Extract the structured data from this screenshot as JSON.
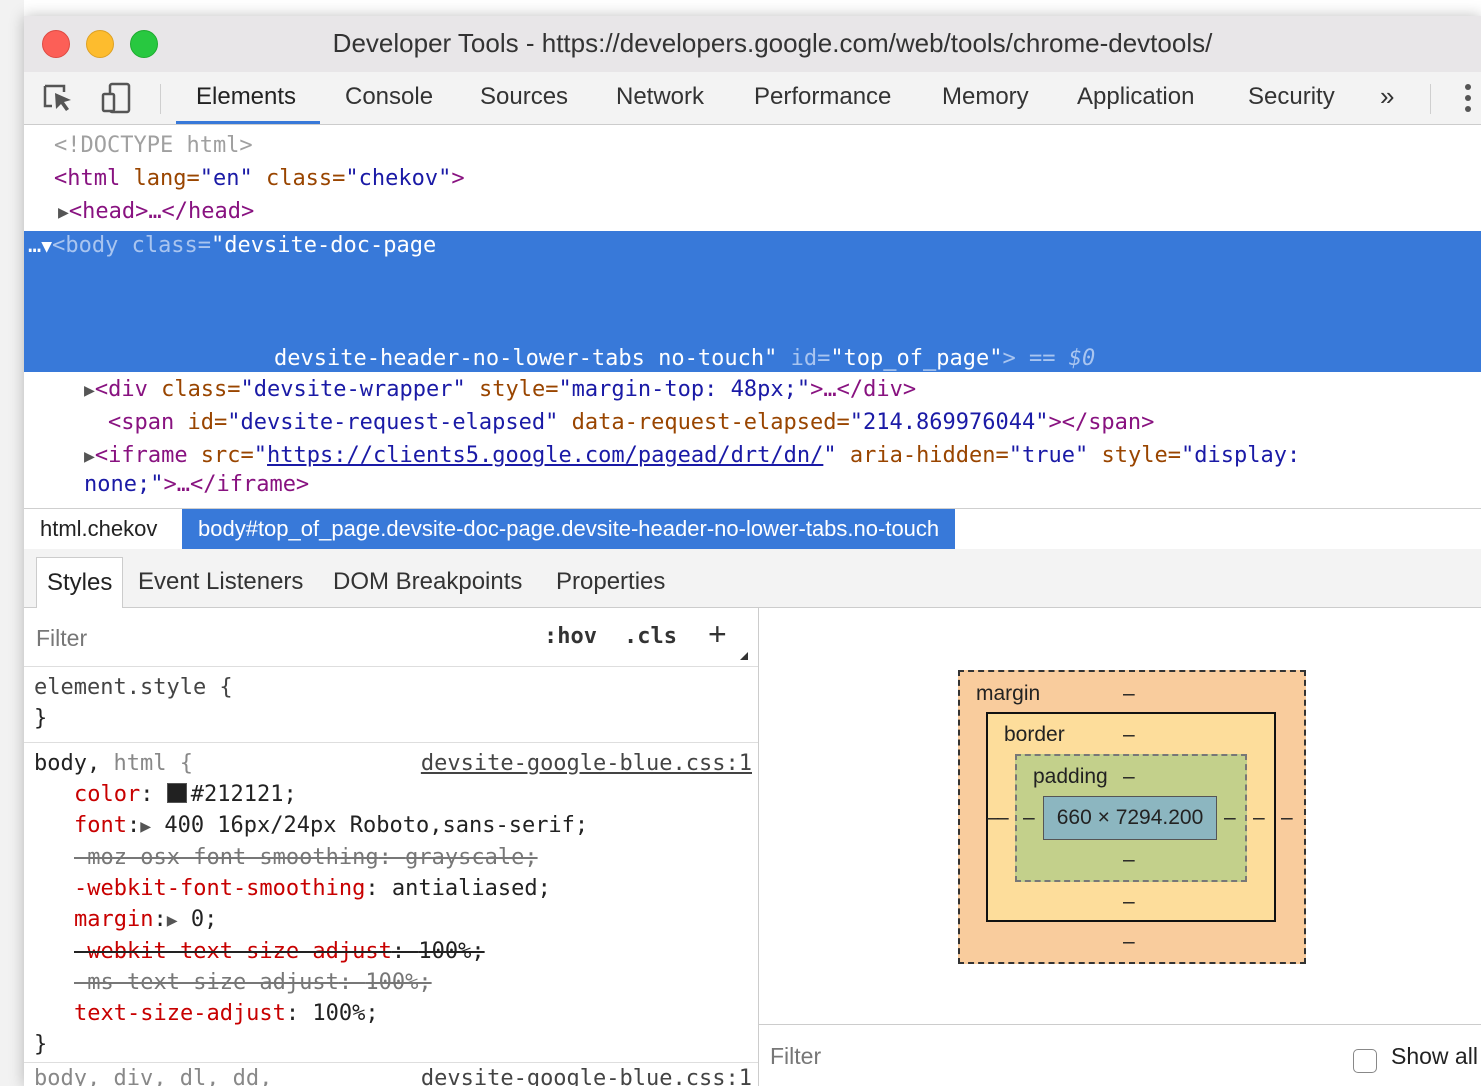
{
  "window": {
    "title": "Developer Tools - https://developers.google.com/web/tools/chrome-devtools/",
    "traffic_lights": {
      "close": "#fc5f57",
      "minimize": "#fdbc2e",
      "zoom": "#28c840"
    }
  },
  "toolbar": {
    "icons": [
      "inspect-element-icon",
      "device-toolbar-icon",
      "more-menu-icon"
    ],
    "tabs": [
      "Elements",
      "Console",
      "Sources",
      "Network",
      "Performance",
      "Memory",
      "Application",
      "Security"
    ],
    "active_tab": "Elements",
    "overflow": "»"
  },
  "dom": {
    "doctype": "<!DOCTYPE html>",
    "html": {
      "open": "<html",
      "lang_name": " lang=",
      "lang_value": "\"en\"",
      "class_name": " class=",
      "class_value": "\"chekov\"",
      "close": ">"
    },
    "head": {
      "text": "<head>…</head>"
    },
    "body": {
      "dots": "…",
      "open": "<body",
      "class_name": " class=",
      "class_value_1": "\"devsite-doc-page",
      "class_value_2": "devsite-header-no-lower-tabs no-touch\"",
      "id_name": " id=",
      "id_value": "\"top_of_page\"",
      "close": ">",
      "eq": " == $0"
    },
    "div": {
      "open": "<div",
      "class_name": " class=",
      "class_value": "\"devsite-wrapper\"",
      "style_name": " style=",
      "style_value": "\"margin-top: 48px;\"",
      "close": ">…</div>"
    },
    "span": {
      "open": "<span",
      "id_name": " id=",
      "id_value": "\"devsite-request-elapsed\"",
      "data_name": " data-request-elapsed=",
      "data_value": "\"214.869976044\"",
      "close": "></span>"
    },
    "iframe": {
      "open": "<iframe",
      "src_name": " src=",
      "src_q": "\"",
      "src_link": "https://clients5.google.com/pagead/drt/dn/",
      "src_q2": "\"",
      "aria_name": " aria-hidden=",
      "aria_value": "\"true\"",
      "style_name": " style=",
      "style_value_1": "\"display:",
      "style_value_2": "none;\"",
      "close": ">…</iframe>"
    }
  },
  "breadcrumbs": [
    "html.chekov",
    "body#top_of_page.devsite-doc-page.devsite-header-no-lower-tabs.no-touch"
  ],
  "subtabs": [
    "Styles",
    "Event Listeners",
    "DOM Breakpoints",
    "Properties"
  ],
  "styles": {
    "filter_placeholder": "Filter",
    "hov": ":hov",
    "cls": ".cls",
    "add": "+",
    "element_style": {
      "selector": "element.style {",
      "close": "}"
    },
    "rule1": {
      "selector_a": "body, ",
      "selector_b": "html {",
      "source": "devsite-google-blue.css:1",
      "props": [
        {
          "name": "color",
          "value": "#212121;",
          "swatch": "#212121",
          "struck": false
        },
        {
          "name": "font",
          "value": "400 16px/24px Roboto,sans-serif;",
          "expand": true,
          "struck": false
        },
        {
          "name": "-moz-osx-font-smoothing",
          "value": "grayscale;",
          "struck": true,
          "invalid": true
        },
        {
          "name": "-webkit-font-smoothing",
          "value": "antialiased;",
          "struck": false
        },
        {
          "name": "margin",
          "value": "0;",
          "expand": true,
          "struck": false
        },
        {
          "name": "-webkit-text-size-adjust",
          "value": "100%;",
          "struck": true
        },
        {
          "name": "-ms-text-size-adjust",
          "value": "100%;",
          "struck": true,
          "invalid": true
        },
        {
          "name": "text-size-adjust",
          "value": "100%;",
          "struck": false
        }
      ],
      "close": "}"
    },
    "rule2": {
      "selector": "body, div, dl, dd,",
      "source": "devsite-google-blue.css:1"
    }
  },
  "boxmodel": {
    "margin_label": "margin",
    "border_label": "border",
    "padding_label": "padding",
    "dash": "–",
    "content": "660 × 7294.200",
    "colors": {
      "margin": "#f9cc9d",
      "border": "#fddd9b",
      "padding": "#c3d08b",
      "content": "#8cb6c0"
    }
  },
  "computed": {
    "filter_placeholder": "Filter",
    "show_all": "Show all"
  }
}
